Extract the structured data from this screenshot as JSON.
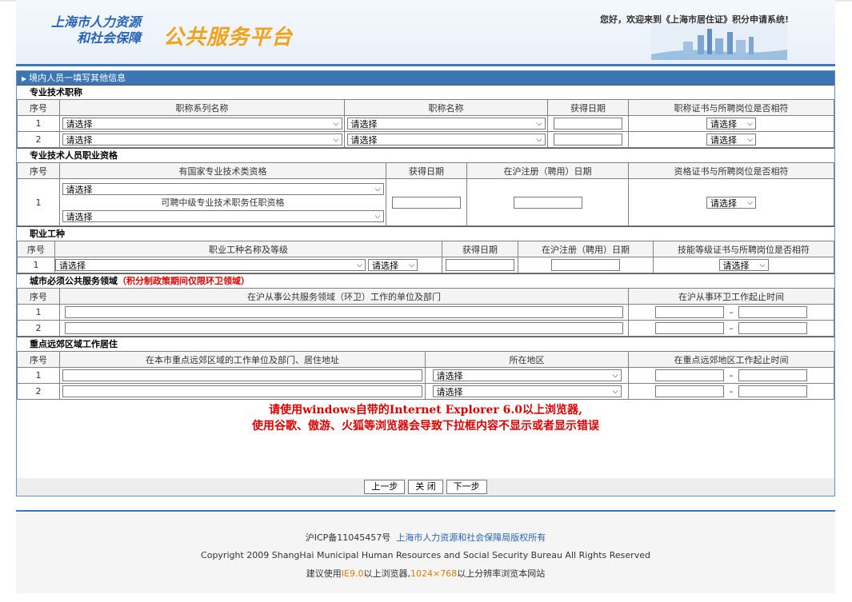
{
  "header": {
    "logo_line1": "上海市人力资源",
    "logo_line2": "和社会保障",
    "logo_big": "公共服务平台",
    "welcome": "您好，欢迎来到《上海市居住证》积分申请系统!"
  },
  "form": {
    "title": "境内人员一填写其他信息",
    "select_placeholder": "请选择",
    "sec1": {
      "title": "专业技术职称",
      "headers": [
        "序号",
        "职称系列名称",
        "职称名称",
        "获得日期",
        "职称证书与所聘岗位是否相符"
      ],
      "rows": [
        "1",
        "2"
      ]
    },
    "sec2": {
      "title": "专业技术人员职业资格",
      "headers": [
        "序号",
        "有国家专业技术类资格",
        "获得日期",
        "在沪注册（聘用）日期",
        "资格证书与所聘岗位是否相符"
      ],
      "row": "1",
      "middle_label": "可聘中级专业技术职务任职资格"
    },
    "sec3": {
      "title": "职业工种",
      "headers": [
        "序号",
        "职业工种名称及等级",
        "获得日期",
        "在沪注册（聘用）日期",
        "技能等级证书与所聘岗位是否相符"
      ],
      "row": "1"
    },
    "sec4": {
      "title": "城市必须公共服务领域",
      "title_note": "（积分制政策期间仅限环卫领域）",
      "headers": [
        "序号",
        "在沪从事公共服务领域（环卫）工作的单位及部门",
        "在沪从事环卫工作起止时间"
      ],
      "rows": [
        "1",
        "2"
      ],
      "dash": "–"
    },
    "sec5": {
      "title": "重点远郊区域工作居住",
      "headers": [
        "序号",
        "在本市重点远郊区域的工作单位及部门、居住地址",
        "所在地区",
        "在重点远郊地区工作起止时间"
      ],
      "rows": [
        "1",
        "2"
      ],
      "dash": "–"
    },
    "notice_line1": "请使用windows自带的Internet Explorer 6.0以上浏览器,",
    "notice_line2": "使用谷歌、傲游、火狐等浏览器会导致下拉框内容不显示或者显示错误",
    "buttons": {
      "prev": "上一步",
      "close": "关 闭",
      "next": "下一步"
    }
  },
  "footer": {
    "icp": "沪ICP备11045457号",
    "owner": "上海市人力资源和社会保障局版权所有",
    "copyright": "Copyright 2009 ShangHai Municipal Human Resources and Social Security Bureau All Rights Reserved",
    "tip_prefix": "建议使用",
    "tip_ie": "IE9.0",
    "tip_mid": "以上浏览器,",
    "tip_res": "1024×768",
    "tip_suffix": "以上分辨率浏览本网站"
  }
}
